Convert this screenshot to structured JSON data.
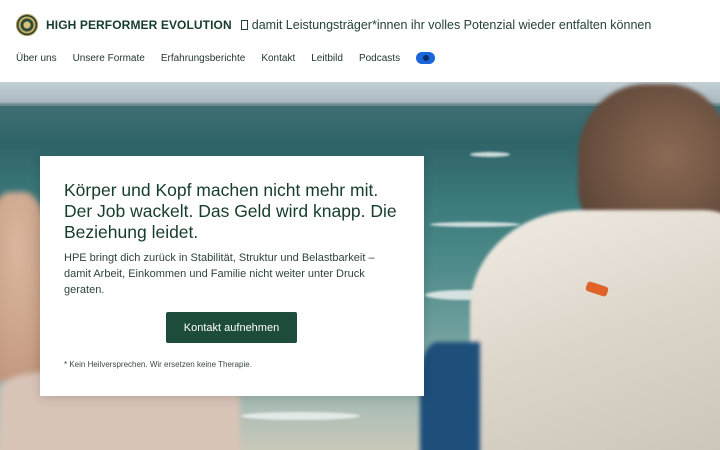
{
  "header": {
    "logo_icon": "emblem-logo",
    "site_title": "HIGH PERFORMER EVOLUTION",
    "tagline_icon": "missing-glyph-icon",
    "tagline": "damit Leistungsträger*innen ihr volles Potenzial wieder entfalten können"
  },
  "nav": {
    "items": [
      {
        "label": "Über uns"
      },
      {
        "label": "Unsere Formate"
      },
      {
        "label": "Erfahrungsberichte"
      },
      {
        "label": "Kontakt"
      },
      {
        "label": "Leitbild"
      },
      {
        "label": "Podcasts"
      }
    ],
    "social_icon": "facebook-icon",
    "social_color": "#1a66d9"
  },
  "hero": {
    "heading": "Körper und Kopf machen nicht mehr mit. Der Job wackelt. Das Geld wird knapp. Die Beziehung leidet.",
    "body": "HPE bringt dich zurück in Stabilität, Struktur und Belastbarkeit – damit Arbeit, Einkommen und Familie nicht weiter unter Druck geraten.",
    "cta_label": "Kontakt aufnehmen",
    "cta_color": "#1d4d3a",
    "disclaimer": "* Kein Heilversprechen. Wir ersetzen keine Therapie."
  },
  "colors": {
    "brand_green": "#163c2c",
    "accent_orange": "#e0632a"
  }
}
